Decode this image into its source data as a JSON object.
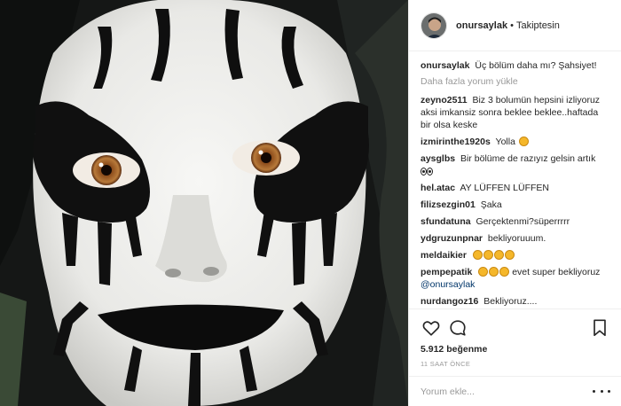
{
  "post": {
    "username": "onursaylak",
    "follow_status": "Takiptesin",
    "separator": "•"
  },
  "caption": {
    "username": "onursaylak",
    "text": "Üç bölüm daha mı? Şahsiyet!"
  },
  "load_more": "Daha fazla yorum yükle",
  "comments": [
    {
      "user": "zeyno2511",
      "text": "Biz 3 bolumün hepsini izliyoruz aksi imkansiz sonra beklee beklee..haftada bir olsa keske"
    },
    {
      "user": "izmirinthe1920s",
      "text": "Yolla"
    },
    {
      "user": "aysglbs",
      "text": "Bir bölüme de razıyız gelsin artık"
    },
    {
      "user": "hel.atac",
      "text": "AY LÜFFEN LÜFFEN"
    },
    {
      "user": "filizsezgin01",
      "text": "Şaka"
    },
    {
      "user": "sfundatuna",
      "text": "Gerçektenmi?süperrrrr"
    },
    {
      "user": "ydgruzunpnar",
      "text": "bekliyoruuum."
    },
    {
      "user": "meldaikier",
      "text": ""
    },
    {
      "user": "pempepatik",
      "text": "evet super bekliyoruz",
      "mention": "@onursaylak"
    },
    {
      "user": "nurdangoz16",
      "text": "Bekliyoruz...."
    }
  ],
  "icons": {
    "like": "heart-outline-icon",
    "comment": "speech-bubble-icon",
    "save": "bookmark-icon",
    "options": "more-options-icon"
  },
  "likes": "5.912 beğenme",
  "timestamp": "11 SAAT ÖNCE",
  "add_comment": {
    "placeholder": "Yorum ekle..."
  },
  "colors": {
    "text": "#262626",
    "muted": "#999999",
    "border": "#efefef",
    "link": "#003569"
  }
}
